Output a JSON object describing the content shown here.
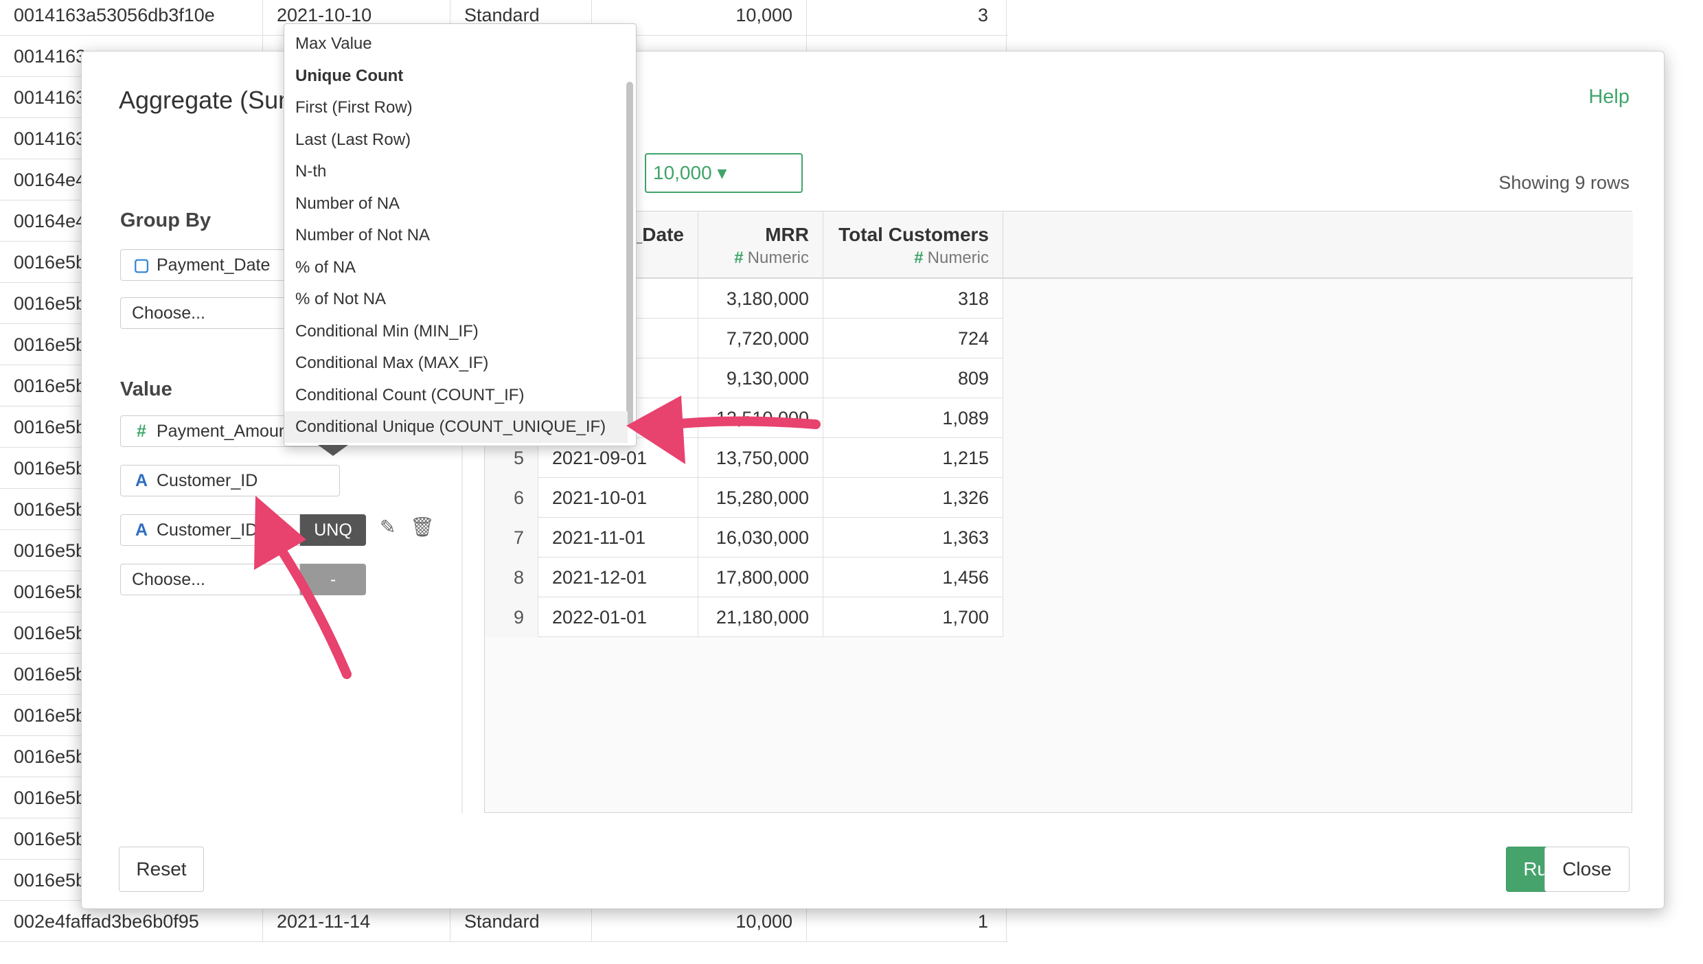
{
  "background_table": {
    "rows": [
      {
        "id": "0014163a53056db3f10e",
        "date": "2021-10-10",
        "plan": "Standard",
        "amount": "10,000",
        "count": "3"
      },
      {
        "id": "0014163",
        "date": "",
        "plan": "",
        "amount": "",
        "count": ""
      },
      {
        "id": "0014163",
        "date": "",
        "plan": "",
        "amount": "",
        "count": ""
      },
      {
        "id": "0014163",
        "date": "",
        "plan": "",
        "amount": "",
        "count": ""
      },
      {
        "id": "00164e4",
        "date": "",
        "plan": "",
        "amount": "",
        "count": ""
      },
      {
        "id": "00164e4",
        "date": "",
        "plan": "",
        "amount": "",
        "count": ""
      },
      {
        "id": "0016e5b",
        "date": "",
        "plan": "",
        "amount": "",
        "count": ""
      },
      {
        "id": "0016e5b",
        "date": "",
        "plan": "",
        "amount": "",
        "count": ""
      },
      {
        "id": "0016e5b",
        "date": "",
        "plan": "",
        "amount": "",
        "count": ""
      },
      {
        "id": "0016e5b",
        "date": "",
        "plan": "",
        "amount": "",
        "count": ""
      },
      {
        "id": "0016e5b",
        "date": "",
        "plan": "",
        "amount": "",
        "count": ""
      },
      {
        "id": "0016e5b",
        "date": "",
        "plan": "",
        "amount": "",
        "count": ""
      },
      {
        "id": "0016e5b",
        "date": "",
        "plan": "",
        "amount": "",
        "count": ""
      },
      {
        "id": "0016e5b",
        "date": "",
        "plan": "",
        "amount": "",
        "count": ""
      },
      {
        "id": "0016e5b",
        "date": "",
        "plan": "",
        "amount": "",
        "count": ""
      },
      {
        "id": "0016e5b",
        "date": "",
        "plan": "",
        "amount": "",
        "count": ""
      },
      {
        "id": "0016e5b",
        "date": "",
        "plan": "",
        "amount": "",
        "count": ""
      },
      {
        "id": "0016e5b",
        "date": "",
        "plan": "",
        "amount": "",
        "count": ""
      },
      {
        "id": "0016e5b",
        "date": "",
        "plan": "",
        "amount": "",
        "count": ""
      },
      {
        "id": "0016e5b",
        "date": "",
        "plan": "",
        "amount": "",
        "count": ""
      },
      {
        "id": "0016e5b",
        "date": "",
        "plan": "",
        "amount": "",
        "count": ""
      },
      {
        "id": "0016e5b",
        "date": "",
        "plan": "",
        "amount": "",
        "count": ""
      },
      {
        "id": "002e4faffad3be6b0f95",
        "date": "2021-11-14",
        "plan": "Standard",
        "amount": "10,000",
        "count": "1"
      }
    ]
  },
  "modal": {
    "title": "Aggregate (Summarize)",
    "help": "Help",
    "group_by_label": "Group By",
    "group_by_field": "Payment_Date",
    "group_by_choose": "Choose...",
    "value_label": "Value",
    "value_fields": [
      {
        "name": "Payment_Amount",
        "type_icon": "#",
        "agg": ""
      },
      {
        "name": "Customer_ID",
        "type_icon": "A",
        "agg": ""
      },
      {
        "name": "Customer_ID",
        "type_icon": "A",
        "agg": "UNQ"
      }
    ],
    "value_choose": "Choose...",
    "value_choose_agg": "-",
    "filter_value": "10,000",
    "showing": "Showing 9 rows",
    "reset": "Reset",
    "run": "Run",
    "close": "Close",
    "grid": {
      "columns": [
        {
          "name": "_Date",
          "type": ""
        },
        {
          "name": "MRR",
          "type": "Numeric"
        },
        {
          "name": "Total Customers",
          "type": "Numeric"
        }
      ],
      "rows": [
        {
          "idx": "",
          "date": "01",
          "mrr": "3,180,000",
          "tc": "318"
        },
        {
          "idx": "",
          "date": "01",
          "mrr": "7,720,000",
          "tc": "724"
        },
        {
          "idx": "",
          "date": "01",
          "mrr": "9,130,000",
          "tc": "809"
        },
        {
          "idx": "",
          "date": "",
          "mrr": "12,510,000",
          "tc": "1,089"
        },
        {
          "idx": "5",
          "date": "2021-09-01",
          "mrr": "13,750,000",
          "tc": "1,215"
        },
        {
          "idx": "6",
          "date": "2021-10-01",
          "mrr": "15,280,000",
          "tc": "1,326"
        },
        {
          "idx": "7",
          "date": "2021-11-01",
          "mrr": "16,030,000",
          "tc": "1,363"
        },
        {
          "idx": "8",
          "date": "2021-12-01",
          "mrr": "17,800,000",
          "tc": "1,456"
        },
        {
          "idx": "9",
          "date": "2022-01-01",
          "mrr": "21,180,000",
          "tc": "1,700"
        }
      ]
    }
  },
  "dropdown": {
    "items": [
      "Max Value",
      "Unique Count",
      "First (First Row)",
      "Last (Last Row)",
      "N-th",
      "Number of NA",
      "Number of Not NA",
      "% of NA",
      "% of Not NA",
      "Conditional Min (MIN_IF)",
      "Conditional Max (MAX_IF)",
      "Conditional Count (COUNT_IF)",
      "Conditional Unique (COUNT_UNIQUE_IF)"
    ],
    "selected": "Unique Count",
    "highlighted": "Conditional Unique (COUNT_UNIQUE_IF)"
  },
  "colors": {
    "accent": "#3fa46a",
    "annotation_arrow": "#e8426e"
  }
}
